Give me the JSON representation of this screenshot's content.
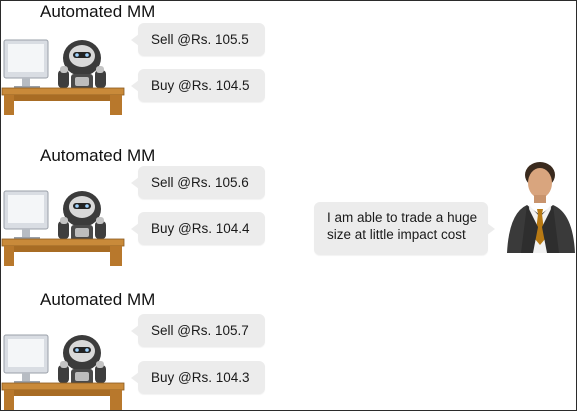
{
  "rows": [
    {
      "label": "Automated MM",
      "sell": "Sell @Rs. 105.5",
      "buy": "Buy @Rs. 104.5"
    },
    {
      "label": "Automated MM",
      "sell": "Sell @Rs. 105.6",
      "buy": "Buy @Rs. 104.4"
    },
    {
      "label": "Automated MM",
      "sell": "Sell @Rs. 105.7",
      "buy": "Buy @Rs. 104.3"
    }
  ],
  "trader": {
    "message": "I am able to trade a huge size at little impact cost"
  },
  "colors": {
    "bubble": "#ececec",
    "desk": "#c98a3a",
    "tie": "#b87a14"
  },
  "icons": [
    "robot-icon",
    "computer-monitor-icon",
    "desk-icon",
    "businessman-icon"
  ]
}
